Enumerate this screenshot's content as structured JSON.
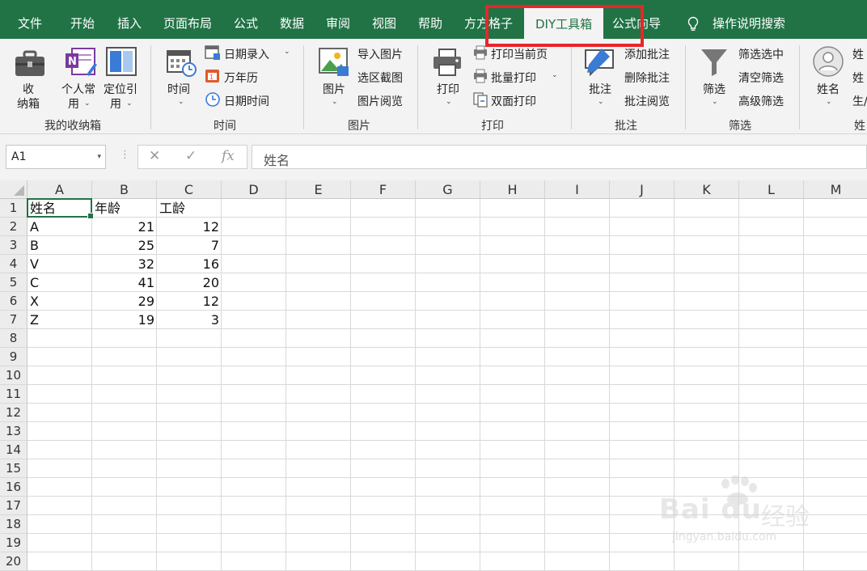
{
  "menu": {
    "tabs": [
      "文件",
      "开始",
      "插入",
      "页面布局",
      "公式",
      "数据",
      "审阅",
      "视图",
      "帮助",
      "方方格子",
      "DIY工具箱",
      "公式向导"
    ],
    "search": "操作说明搜索"
  },
  "ribbon": {
    "g1": {
      "label": "我的收纳箱",
      "b1": "收",
      "b1b": "纳箱",
      "b2": "个人常",
      "b2b": "用",
      "b3": "定位引",
      "b3b": "用"
    },
    "g2": {
      "label": "时间",
      "big": "时间",
      "i1": "日期录入",
      "i2": "万年历",
      "i3": "日期时间"
    },
    "g3": {
      "label": "图片",
      "big": "图片",
      "i1": "导入图片",
      "i2": "选区截图",
      "i3": "图片阅览"
    },
    "g4": {
      "label": "打印",
      "big": "打印",
      "i1": "打印当前页",
      "i2": "批量打印",
      "i3": "双面打印"
    },
    "g5": {
      "label": "批注",
      "big": "批注",
      "i1": "添加批注",
      "i2": "删除批注",
      "i3": "批注阅览"
    },
    "g6": {
      "label": "筛选",
      "big": "筛选",
      "i1": "筛选选中",
      "i2": "清空筛选",
      "i3": "高级筛选"
    },
    "g7": {
      "label": "姓",
      "big": "姓名",
      "i1": "姓",
      "i2": "姓",
      "i3": "生/"
    }
  },
  "formula_bar": {
    "cell_ref": "A1",
    "content": "姓名",
    "fx": "fx"
  },
  "sheet": {
    "columns": [
      "A",
      "B",
      "C",
      "D",
      "E",
      "F",
      "G",
      "H",
      "I",
      "J",
      "K",
      "L",
      "M"
    ],
    "rows": [
      "1",
      "2",
      "3",
      "4",
      "5",
      "6",
      "7",
      "8",
      "9",
      "10",
      "11",
      "12",
      "13",
      "14",
      "15",
      "16",
      "17",
      "18",
      "19",
      "20"
    ],
    "header": [
      "姓名",
      "年龄",
      "工龄"
    ],
    "data": [
      [
        "A",
        "21",
        "12"
      ],
      [
        "B",
        "25",
        "7"
      ],
      [
        "V",
        "32",
        "16"
      ],
      [
        "C",
        "41",
        "20"
      ],
      [
        "X",
        "29",
        "12"
      ],
      [
        "Z",
        "19",
        "3"
      ]
    ]
  },
  "watermark": {
    "logo": "Bai du",
    "cn": "经验",
    "url": "jingyan.baidu.com"
  },
  "colors": {
    "accent": "#217346",
    "highlight": "#e8262a"
  }
}
